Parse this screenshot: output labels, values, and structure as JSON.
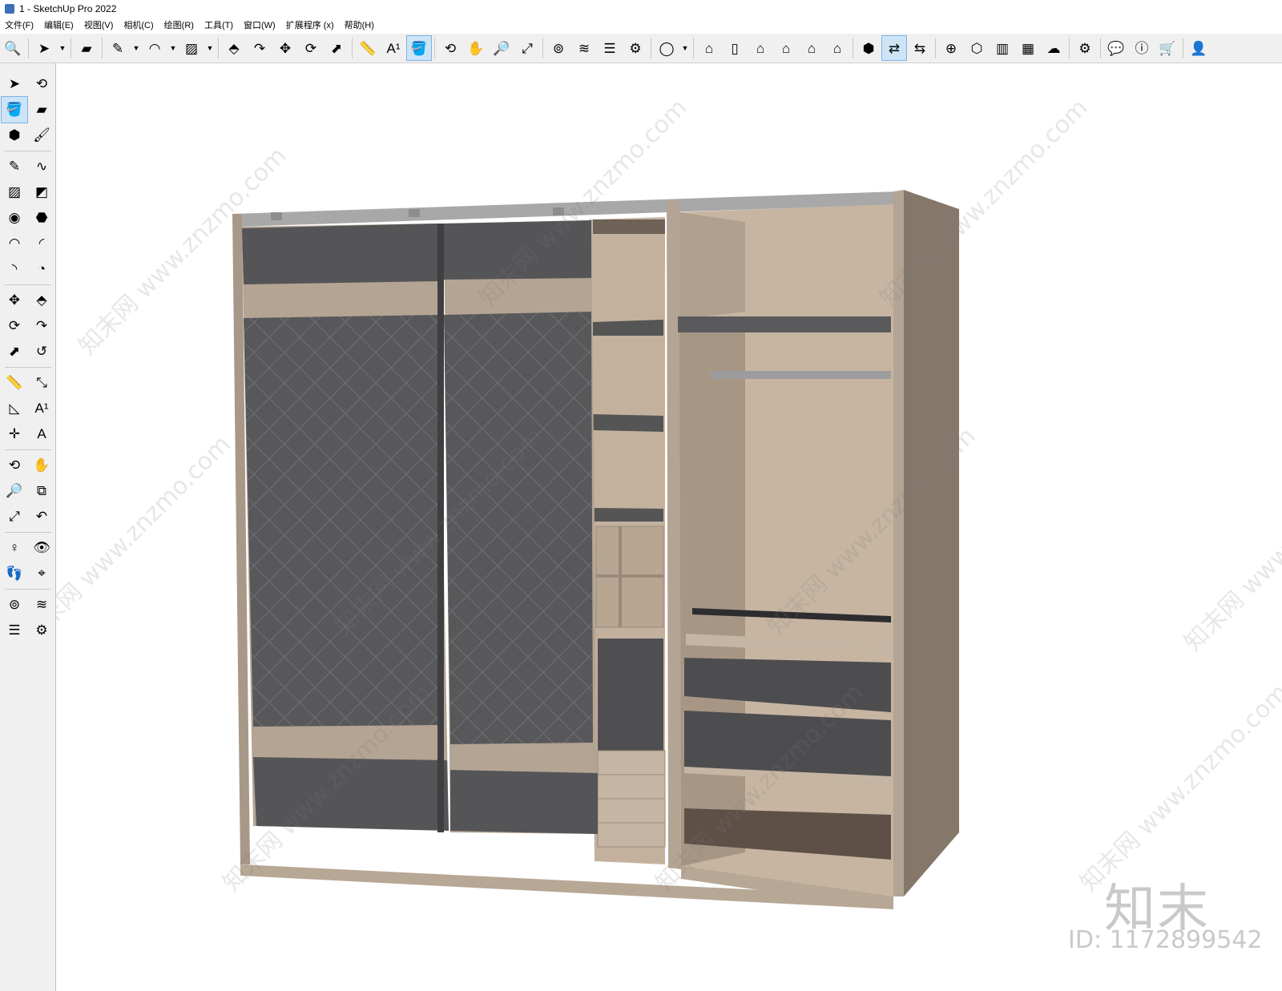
{
  "window": {
    "title": "1 - SketchUp Pro 2022"
  },
  "menu": [
    "文件(F)",
    "编辑(E)",
    "视图(V)",
    "相机(C)",
    "绘图(R)",
    "工具(T)",
    "窗口(W)",
    "扩展程序 (x)",
    "帮助(H)"
  ],
  "toolbar": {
    "items": [
      {
        "icon": "zoom-icon",
        "glyph": "🔍"
      },
      {
        "sep": true
      },
      {
        "icon": "select-icon",
        "glyph": "➤"
      },
      {
        "icon": "dropdown-arrow-icon",
        "glyph": "▼",
        "arrow": true
      },
      {
        "sep": true
      },
      {
        "icon": "eraser-icon",
        "glyph": "▰"
      },
      {
        "sep": true
      },
      {
        "icon": "pencil-icon",
        "glyph": "✎"
      },
      {
        "icon": "dropdown-arrow-icon",
        "glyph": "▼",
        "arrow": true
      },
      {
        "icon": "arc-icon",
        "glyph": "◠"
      },
      {
        "icon": "dropdown-arrow-icon",
        "glyph": "▼",
        "arrow": true
      },
      {
        "icon": "rectangle-icon",
        "glyph": "▨"
      },
      {
        "icon": "dropdown-arrow-icon",
        "glyph": "▼",
        "arrow": true
      },
      {
        "sep": true
      },
      {
        "icon": "push-pull-icon",
        "glyph": "⬘"
      },
      {
        "icon": "follow-me-icon",
        "glyph": "↷"
      },
      {
        "icon": "move-icon",
        "glyph": "✥"
      },
      {
        "icon": "rotate-icon",
        "glyph": "⟳"
      },
      {
        "icon": "scale-icon",
        "glyph": "⬈"
      },
      {
        "sep": true
      },
      {
        "icon": "tape-measure-icon",
        "glyph": "📏"
      },
      {
        "icon": "text-icon",
        "glyph": "A¹"
      },
      {
        "icon": "paint-bucket-icon",
        "glyph": "🪣",
        "selected": true
      },
      {
        "sep": true
      },
      {
        "icon": "orbit-icon",
        "glyph": "⟲"
      },
      {
        "icon": "pan-icon",
        "glyph": "✋"
      },
      {
        "icon": "zoom-tool-icon",
        "glyph": "🔎"
      },
      {
        "icon": "zoom-extents-icon",
        "glyph": "⤢"
      },
      {
        "sep": true
      },
      {
        "icon": "section-plane-icon",
        "glyph": "⊚"
      },
      {
        "icon": "section-display-icon",
        "glyph": "≋"
      },
      {
        "icon": "section-cuts-icon",
        "glyph": "☰"
      },
      {
        "icon": "section-fill-icon",
        "glyph": "⚙"
      },
      {
        "sep": true
      },
      {
        "icon": "user-account-icon",
        "glyph": "◯"
      },
      {
        "icon": "dropdown-arrow-icon",
        "glyph": "▼",
        "arrow": true
      },
      {
        "sep": true
      },
      {
        "icon": "iso-view-icon",
        "glyph": "⌂"
      },
      {
        "icon": "top-view-icon",
        "glyph": "▯"
      },
      {
        "icon": "front-view-icon",
        "glyph": "⌂"
      },
      {
        "icon": "right-view-icon",
        "glyph": "⌂"
      },
      {
        "icon": "back-view-icon",
        "glyph": "⌂"
      },
      {
        "icon": "left-view-icon",
        "glyph": "⌂"
      },
      {
        "sep": true
      },
      {
        "icon": "warehouse-icon",
        "glyph": "⬢"
      },
      {
        "icon": "share-model-icon",
        "glyph": "⇄",
        "selected": true
      },
      {
        "icon": "extension-warehouse-icon",
        "glyph": "⇆"
      },
      {
        "sep": true
      },
      {
        "icon": "add-location-icon",
        "glyph": "⊕"
      },
      {
        "icon": "geo-icon",
        "glyph": "⬡"
      },
      {
        "icon": "style-icon",
        "glyph": "▥"
      },
      {
        "icon": "checker-icon",
        "glyph": "▦"
      },
      {
        "icon": "cloud-upload-icon",
        "glyph": "☁"
      },
      {
        "sep": true
      },
      {
        "icon": "settings-icon",
        "glyph": "⚙"
      },
      {
        "sep": true
      },
      {
        "icon": "message-icon",
        "glyph": "💬"
      },
      {
        "icon": "info-icon",
        "glyph": "ⓘ"
      },
      {
        "icon": "cart-icon",
        "glyph": "🛒"
      },
      {
        "sep": true
      },
      {
        "icon": "profile-icon",
        "glyph": "👤"
      }
    ]
  },
  "left_toolbar": {
    "groups": [
      [
        {
          "icon": "select-icon",
          "glyph": "➤"
        },
        {
          "icon": "lasso-orbit-icon",
          "glyph": "⟲"
        },
        {
          "icon": "paint-bucket-icon",
          "glyph": "🪣",
          "selected": true
        },
        {
          "icon": "eraser-icon",
          "glyph": "▰"
        },
        {
          "icon": "component-icon",
          "glyph": "⬢"
        },
        {
          "icon": "tag-paint-icon",
          "glyph": "🖌"
        }
      ],
      [
        {
          "icon": "pencil-icon",
          "glyph": "✎"
        },
        {
          "icon": "freehand-icon",
          "glyph": "∿"
        },
        {
          "icon": "rectangle-icon",
          "glyph": "▨"
        },
        {
          "icon": "rotated-rectangle-icon",
          "glyph": "◩"
        },
        {
          "icon": "circle-icon",
          "glyph": "◉"
        },
        {
          "icon": "polygon-icon",
          "glyph": "⬣"
        },
        {
          "icon": "arc-icon",
          "glyph": "◠"
        },
        {
          "icon": "two-point-arc-icon",
          "glyph": "◜"
        },
        {
          "icon": "three-point-arc-icon",
          "glyph": "◝"
        },
        {
          "icon": "pie-icon",
          "glyph": "◔"
        }
      ],
      [
        {
          "icon": "move-icon",
          "glyph": "✥"
        },
        {
          "icon": "push-pull-icon",
          "glyph": "⬘"
        },
        {
          "icon": "rotate-icon",
          "glyph": "⟳"
        },
        {
          "icon": "follow-me-icon",
          "glyph": "↷"
        },
        {
          "icon": "scale-icon",
          "glyph": "⬈"
        },
        {
          "icon": "offset-icon",
          "glyph": "↺"
        }
      ],
      [
        {
          "icon": "tape-measure-icon",
          "glyph": "📏"
        },
        {
          "icon": "dimension-icon",
          "glyph": "⤡"
        },
        {
          "icon": "protractor-icon",
          "glyph": "◺"
        },
        {
          "icon": "text-icon",
          "glyph": "A¹"
        },
        {
          "icon": "axes-icon",
          "glyph": "✛"
        },
        {
          "icon": "3d-text-icon",
          "glyph": "A"
        }
      ],
      [
        {
          "icon": "orbit-icon",
          "glyph": "⟲"
        },
        {
          "icon": "pan-icon",
          "glyph": "✋"
        },
        {
          "icon": "zoom-tool-icon",
          "glyph": "🔎"
        },
        {
          "icon": "zoom-window-icon",
          "glyph": "⧉"
        },
        {
          "icon": "zoom-extents-icon",
          "glyph": "⤢"
        },
        {
          "icon": "previous-view-icon",
          "glyph": "↶"
        }
      ],
      [
        {
          "icon": "position-camera-icon",
          "glyph": "♀"
        },
        {
          "icon": "look-around-icon",
          "glyph": "👁"
        },
        {
          "icon": "walk-icon",
          "glyph": "👣"
        },
        {
          "icon": "crosshair-icon",
          "glyph": "⌖"
        }
      ],
      [
        {
          "icon": "section-plane-icon",
          "glyph": "⊚"
        },
        {
          "icon": "section-display-icon",
          "glyph": "≋"
        },
        {
          "icon": "section-cuts-icon",
          "glyph": "☰"
        },
        {
          "icon": "section-fill-icon",
          "glyph": "⚙"
        }
      ]
    ]
  },
  "watermark": {
    "text": "知末网 www.znzmo.com",
    "logo": "知末",
    "id_label": "ID: 1172899542"
  },
  "colors": {
    "frame": "#b4a493",
    "frame_dark": "#8c7d6e",
    "door": "#555558",
    "interior": "#c5b3a0",
    "interior_shadow": "#9a8a7a",
    "rail": "#9c9c9c"
  }
}
